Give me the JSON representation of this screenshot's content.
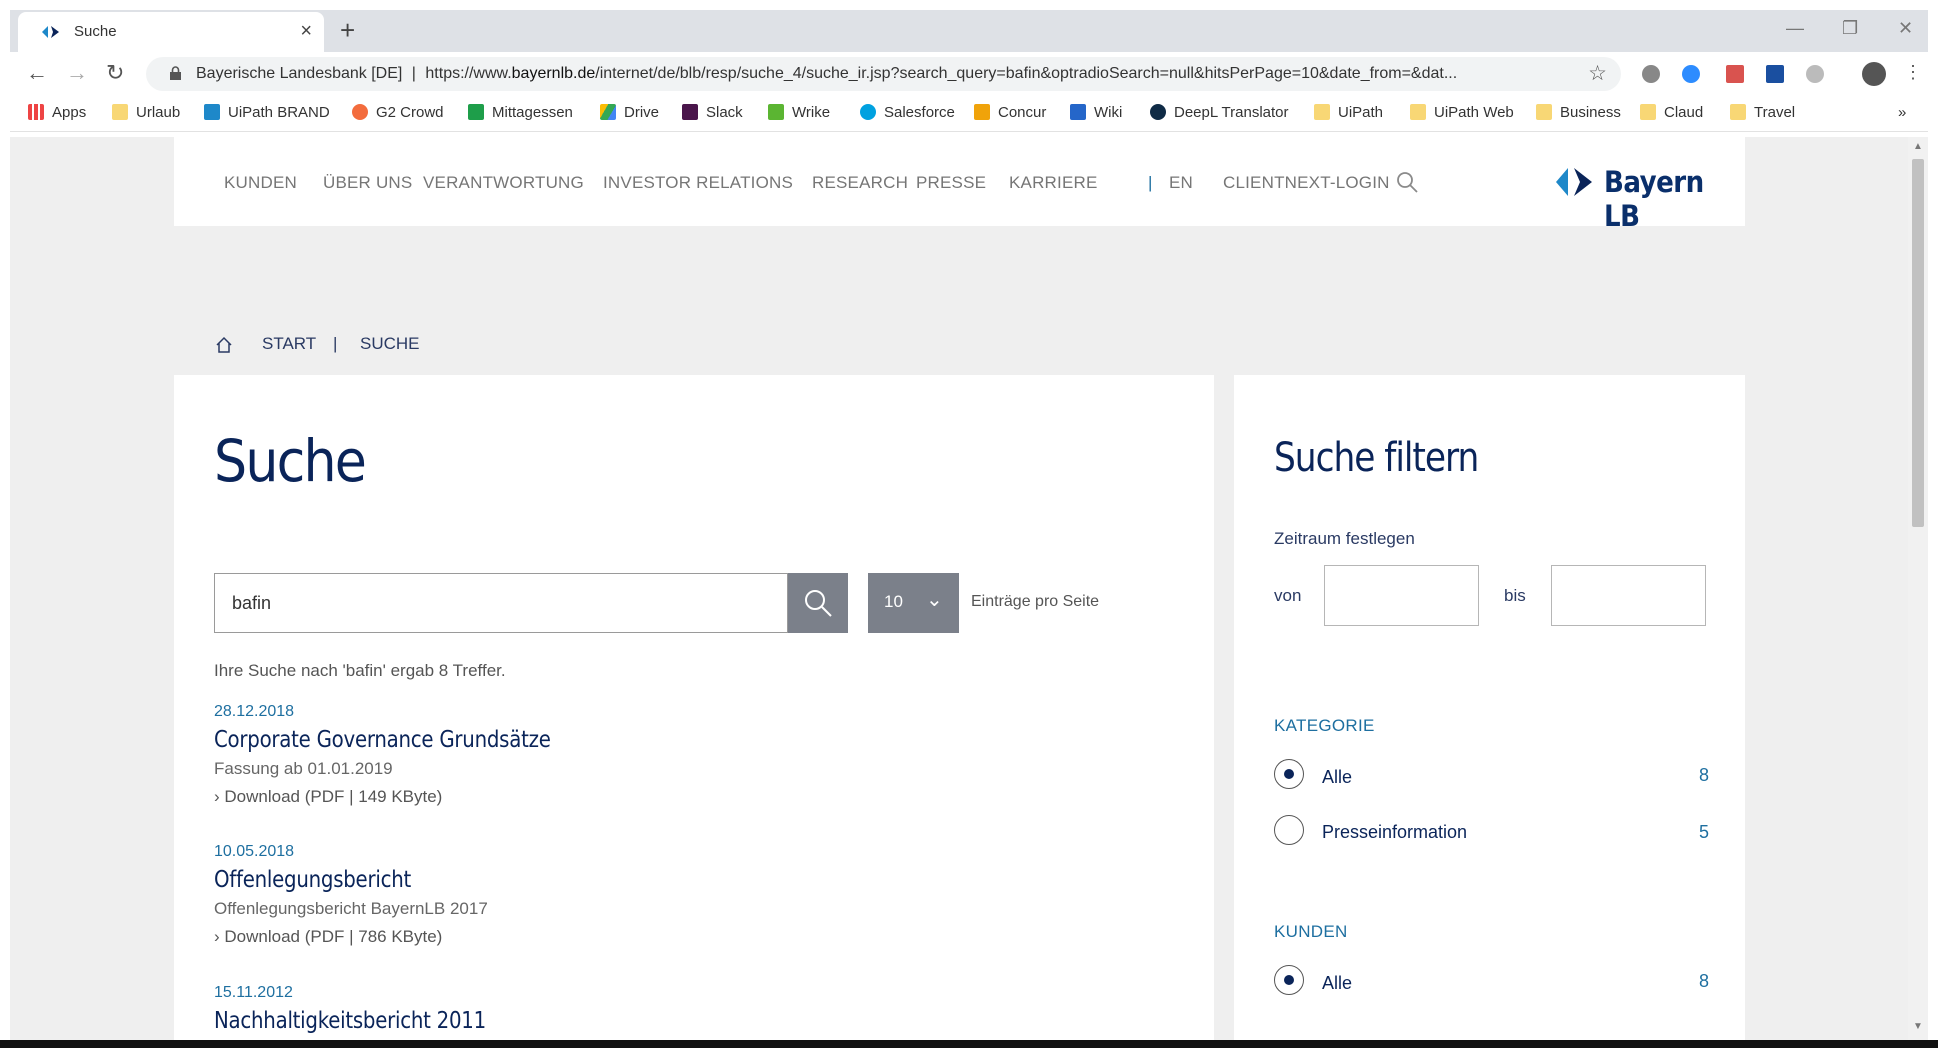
{
  "browser": {
    "tab_title": "Suche",
    "new_tab": "+",
    "url_site": "Bayerische Landesbank [DE]",
    "url_sep": "|",
    "url_prefix": "https://www.",
    "url_domain": "bayernlb.de",
    "url_path": "/internet/de/blb/resp/suche_4/suche_ir.jsp?search_query=bafin&optradioSearch=null&hitsPerPage=10&date_from=&dat..."
  },
  "bookmarks": [
    "Apps",
    "Urlaub",
    "UiPath BRAND",
    "G2 Crowd",
    "Mittagessen",
    "Drive",
    "Slack",
    "Wrike",
    "Salesforce",
    "Concur",
    "Wiki",
    "DeepL Translator",
    "UiPath",
    "UiPath Web",
    "Business",
    "Claud",
    "Travel"
  ],
  "site": {
    "nav": [
      "KUNDEN",
      "ÜBER UNS",
      "VERANTWORTUNG",
      "INVESTOR RELATIONS",
      "RESEARCH",
      "PRESSE",
      "KARRIERE"
    ],
    "nav_sep": "|",
    "lang": "EN",
    "login": "CLIENTNEXT-LOGIN",
    "logo_text": "Bayern LB",
    "breadcrumb": {
      "start": "START",
      "sep": "|",
      "current": "SUCHE"
    }
  },
  "search": {
    "heading": "Suche",
    "query": "bafin",
    "per_page_value": "10",
    "per_page_label": "Einträge pro Seite",
    "result_info": "Ihre Suche nach 'bafin' ergab 8 Treffer."
  },
  "results": [
    {
      "date": "28.12.2018",
      "title": "Corporate Governance Grundsätze",
      "desc": "Fassung ab 01.01.2019",
      "download": "› Download (PDF | 149 KByte)"
    },
    {
      "date": "10.05.2018",
      "title": "Offenlegungsbericht",
      "desc": "Offenlegungsbericht BayernLB 2017",
      "download": "› Download (PDF | 786 KByte)"
    },
    {
      "date": "15.11.2012",
      "title": "Nachhaltigkeitsbericht 2011"
    }
  ],
  "filter": {
    "heading": "Suche filtern",
    "period_label": "Zeitraum festlegen",
    "from_label": "von",
    "to_label": "bis",
    "groups": [
      {
        "title": "KATEGORIE",
        "options": [
          {
            "label": "Alle",
            "count": "8",
            "selected": true
          },
          {
            "label": "Presseinformation",
            "count": "5",
            "selected": false
          }
        ]
      },
      {
        "title": "KUNDEN",
        "options": [
          {
            "label": "Alle",
            "count": "8",
            "selected": true
          }
        ]
      }
    ]
  },
  "colors": {
    "navy": "#0a2459",
    "link_blue": "#1e6fa0",
    "button_gray": "#7b808a",
    "page_bg": "#efefef"
  }
}
